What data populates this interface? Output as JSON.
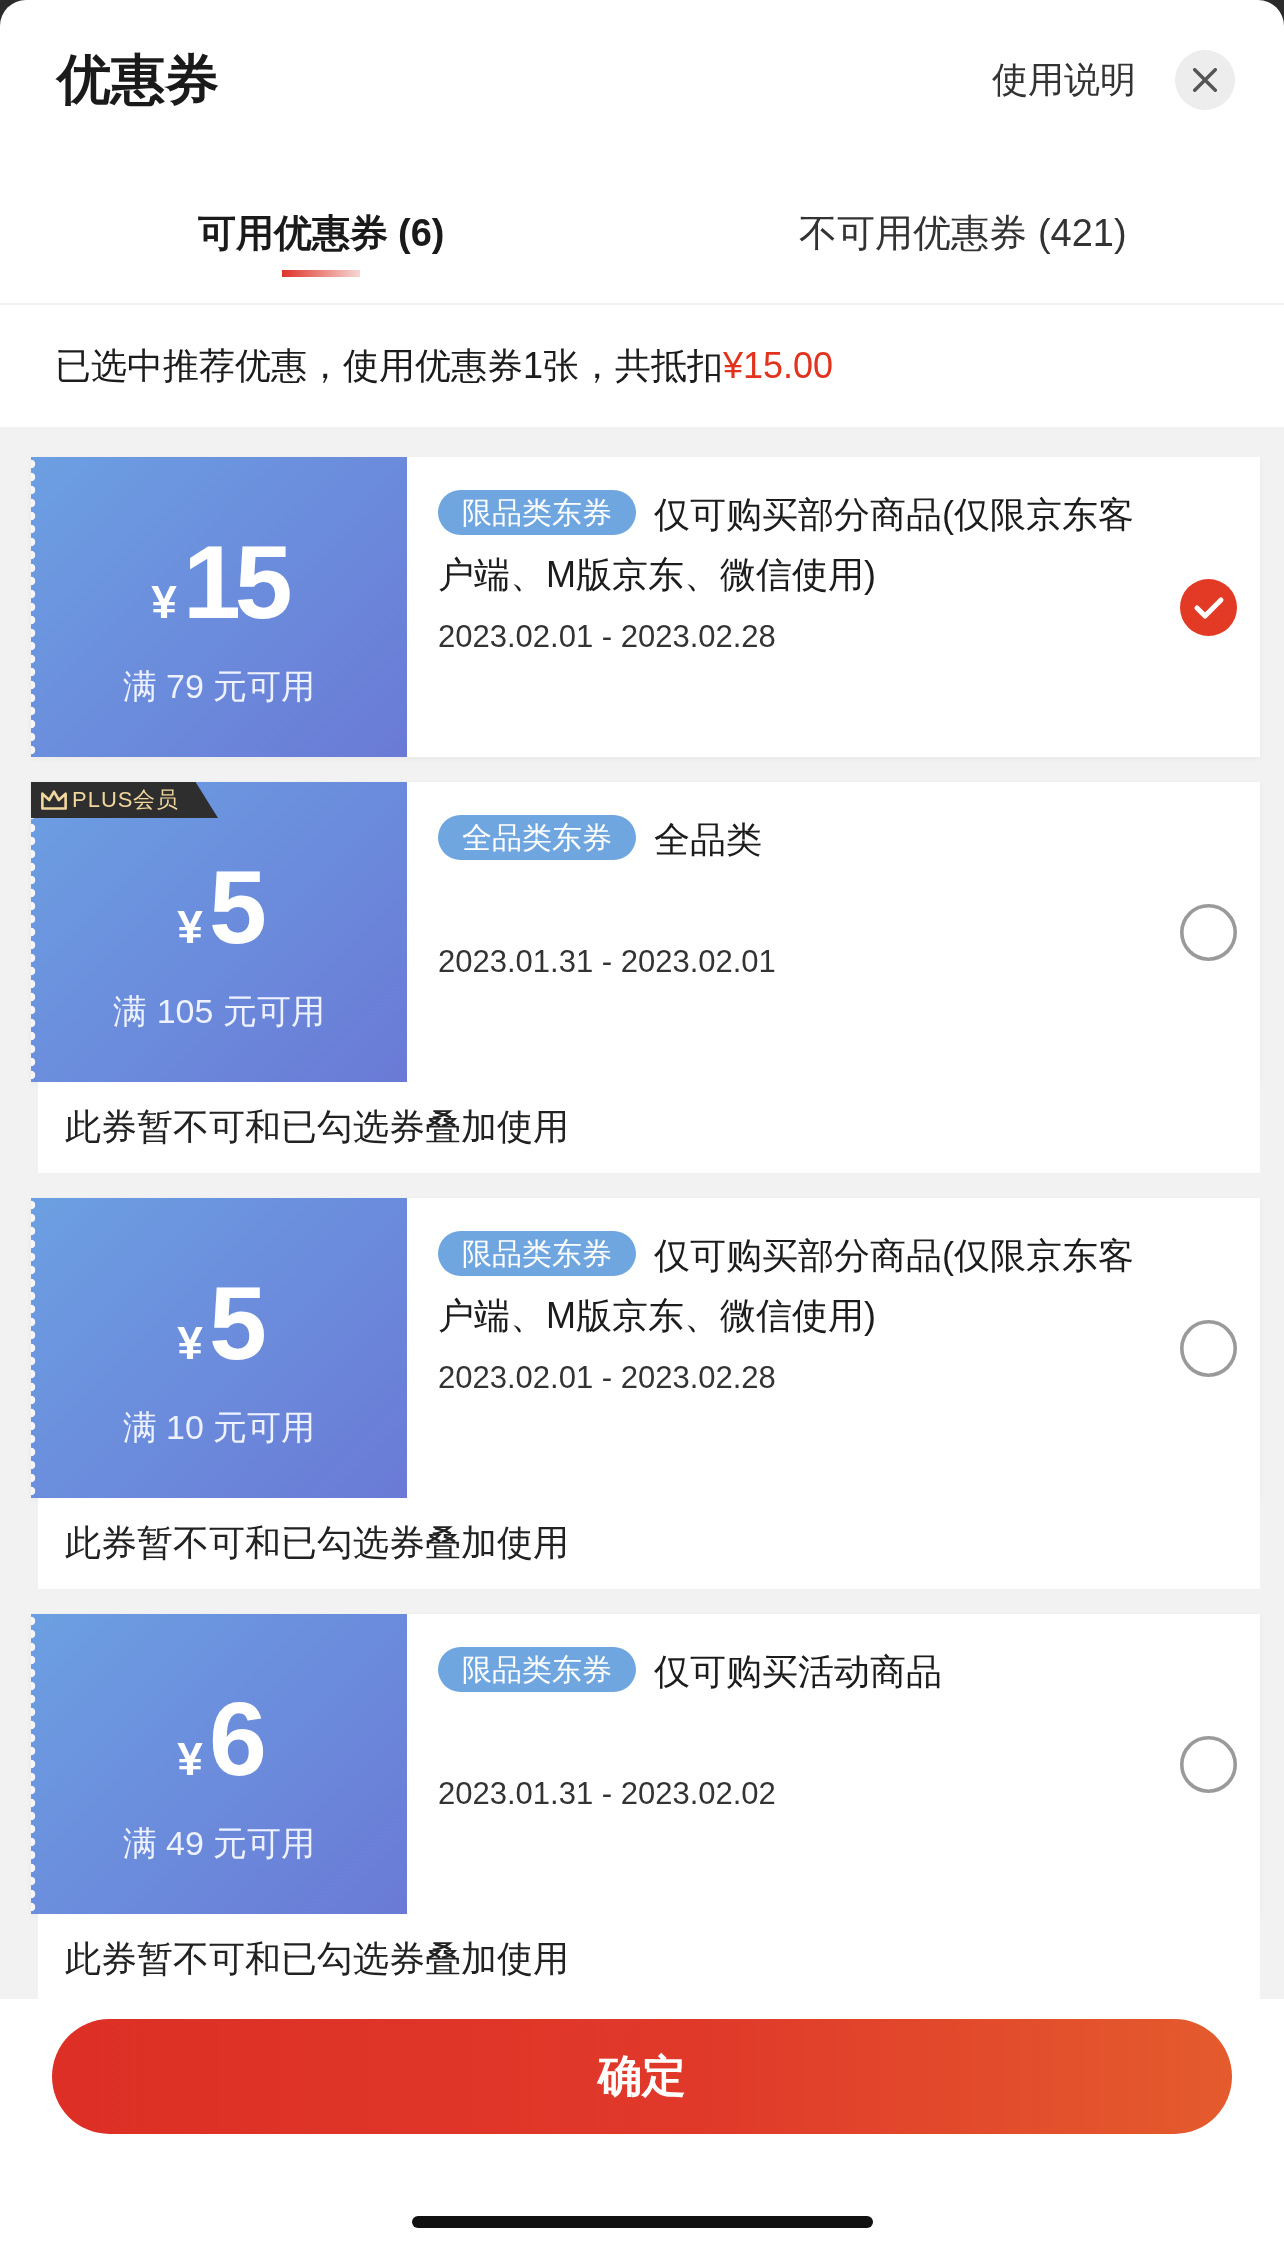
{
  "header": {
    "title": "优惠券",
    "help_link": "使用说明"
  },
  "tabs": [
    {
      "label": "可用优惠券 (6)",
      "selected": true
    },
    {
      "label": "不可用优惠券 (421)",
      "selected": false
    }
  ],
  "summary": {
    "text": "已选中推荐优惠，使用优惠券1张，共抵扣",
    "amount": "¥15.00"
  },
  "coupons": [
    {
      "currency": "¥",
      "amount": "15",
      "condition": "满 79 元可用",
      "tag": "限品类东券",
      "description": "仅可购买部分商品(仅限京东客户端、M版京东、微信使用)",
      "validity": "2023.02.01 - 2023.02.28",
      "selected": true
    },
    {
      "badge": "PLUS会员",
      "currency": "¥",
      "amount": "5",
      "condition": "满 105 元可用",
      "tag": "全品类东券",
      "description": "全品类",
      "validity": "2023.01.31 - 2023.02.01",
      "selected": false,
      "note": "此券暂不可和已勾选券叠加使用"
    },
    {
      "currency": "¥",
      "amount": "5",
      "condition": "满 10 元可用",
      "tag": "限品类东券",
      "description": "仅可购买部分商品(仅限京东客户端、M版京东、微信使用)",
      "validity": "2023.02.01 - 2023.02.28",
      "selected": false,
      "note": "此券暂不可和已勾选券叠加使用"
    },
    {
      "currency": "¥",
      "amount": "6",
      "condition": "满 49 元可用",
      "tag": "限品类东券",
      "description": "仅可购买活动商品",
      "validity": "2023.01.31 - 2023.02.02",
      "selected": false,
      "note": "此券暂不可和已勾选券叠加使用"
    }
  ],
  "confirm_button": "确定"
}
